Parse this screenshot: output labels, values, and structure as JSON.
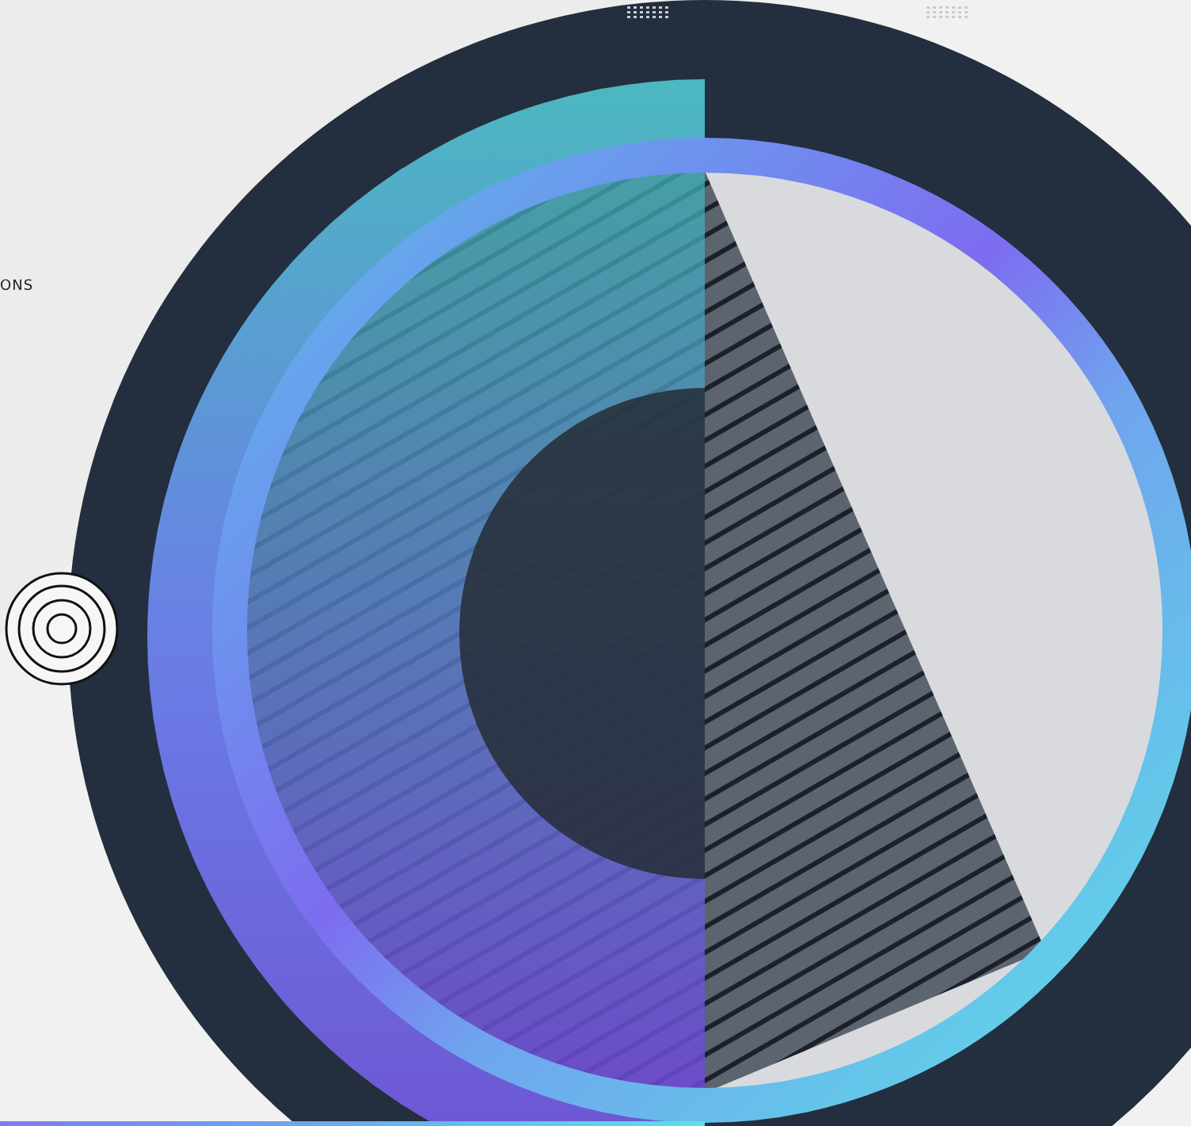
{
  "side_text": "ONS"
}
